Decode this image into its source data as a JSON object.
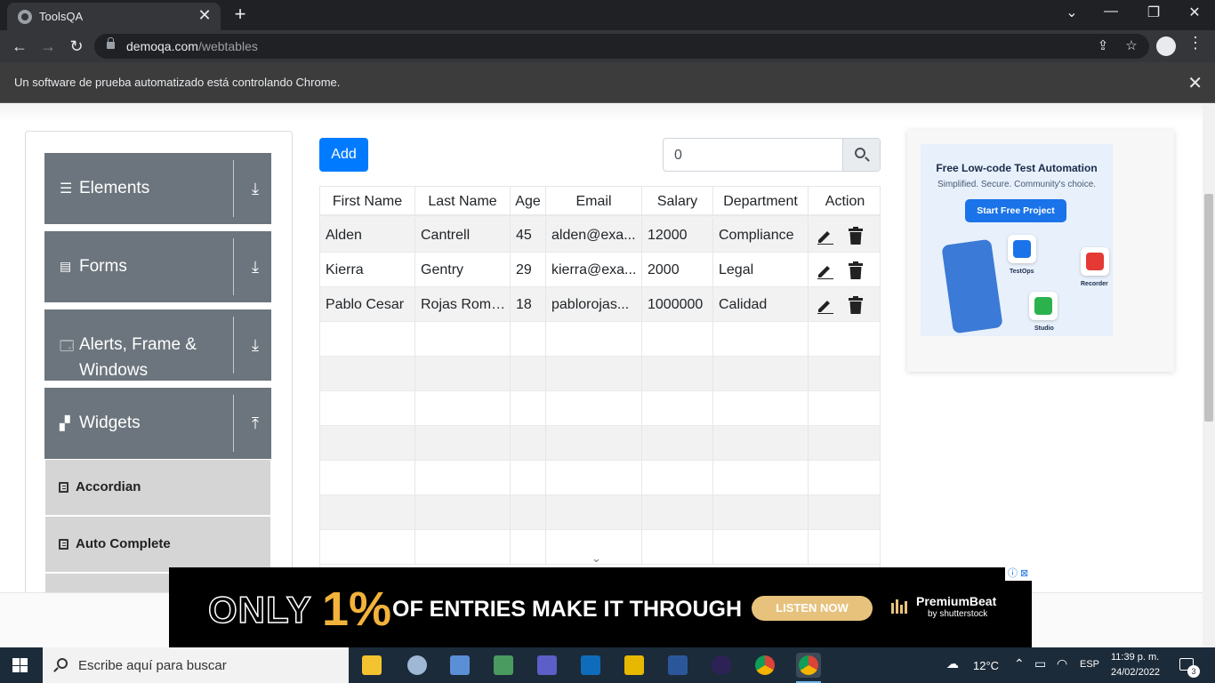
{
  "browser": {
    "tab_title": "ToolsQA",
    "tab_close": "✕",
    "new_tab": "+",
    "url_host": "demoqa.com",
    "url_path": "/webtables",
    "automation_notice": "Un software de prueba automatizado está controlando Chrome.",
    "notice_close": "✕",
    "win_minimize": "⌄",
    "win_min": "—",
    "win_restore": "❐",
    "win_close": "✕"
  },
  "sidebar": {
    "groups": [
      {
        "label": "Elements",
        "icon": "hamburger-icon",
        "arrow": "⤓"
      },
      {
        "label": "Forms",
        "icon": "document-icon",
        "arrow": "⤓"
      },
      {
        "label": "Alerts, Frame &",
        "label2": "Windows",
        "icon": "window-icon",
        "arrow": "⤓"
      },
      {
        "label": "Widgets",
        "icon": "widgets-icon",
        "arrow": "⤒"
      }
    ],
    "widget_items": [
      {
        "label": "Accordian"
      },
      {
        "label": "Auto Complete"
      }
    ]
  },
  "toolbar": {
    "add_label": "Add",
    "search_value": "0"
  },
  "table": {
    "headers": [
      "First Name",
      "Last Name",
      "Age",
      "Email",
      "Salary",
      "Department",
      "Action"
    ],
    "rows": [
      {
        "first": "Alden",
        "last": "Cantrell",
        "age": "45",
        "email": "alden@exa...",
        "salary": "12000",
        "department": "Compliance"
      },
      {
        "first": "Kierra",
        "last": "Gentry",
        "age": "29",
        "email": "kierra@exa...",
        "salary": "2000",
        "department": "Legal"
      },
      {
        "first": "Pablo Cesar",
        "last": "Rojas Rome...",
        "age": "18",
        "email": "pablorojas...",
        "salary": "1000000",
        "department": "Calidad"
      }
    ],
    "empty_rows": 7
  },
  "side_ad": {
    "title": "Free Low-code Test Automation",
    "subtitle": "Simplified. Secure. Community's choice.",
    "cta": "Start Free Project",
    "tiles": [
      "TestOps",
      "Recorder",
      "Studio"
    ]
  },
  "bottom_ad": {
    "only": "ONLY",
    "pct": "1%",
    "headline": "OF ENTRIES MAKE IT THROUGH",
    "cta": "LISTEN NOW",
    "brand": "PremiumBeat",
    "brand_sub": "by shutterstock"
  },
  "taskbar": {
    "search_placeholder": "Escribe aquí para buscar",
    "temperature": "12°C",
    "language": "ESP",
    "time": "11:39 p. m.",
    "date": "24/02/2022",
    "notifications": "3"
  },
  "colors": {
    "accent": "#007bff",
    "sidebar_group": "#6c757d",
    "sidebar_item": "#d5d5d5"
  }
}
